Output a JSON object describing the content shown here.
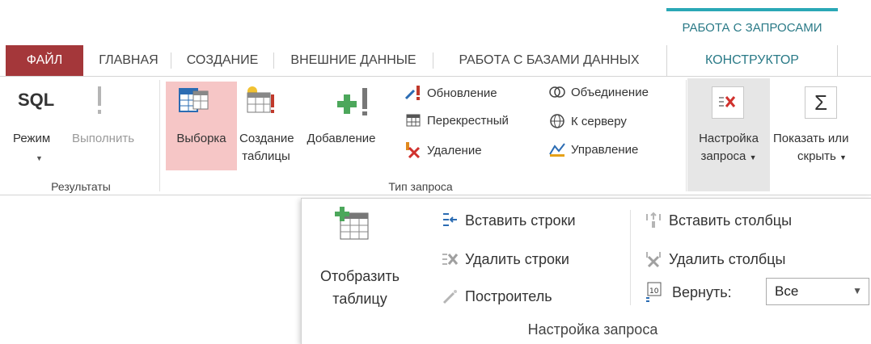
{
  "context_tab_header": "РАБОТА С ЗАПРОСАМИ",
  "tabs": [
    {
      "label": "ФАЙЛ"
    },
    {
      "label": "ГЛАВНАЯ"
    },
    {
      "label": "СОЗДАНИЕ"
    },
    {
      "label": "ВНЕШНИЕ ДАННЫЕ"
    },
    {
      "label": "РАБОТА С БАЗАМИ ДАННЫХ"
    },
    {
      "label": "КОНСТРУКТОР",
      "active": true
    }
  ],
  "ribbon": {
    "results": {
      "sql_text": "SQL",
      "mode_label": "Режим",
      "run_label": "Выполнить",
      "group_label": "Результаты"
    },
    "query_type": {
      "select_label": "Выборка",
      "make_table_label_1": "Создание",
      "make_table_label_2": "таблицы",
      "append_label": "Добавление",
      "update_label": "Обновление",
      "crosstab_label": "Перекрестный",
      "delete_label": "Удаление",
      "union_label": "Объединение",
      "passthrough_label": "К серверу",
      "ddl_label": "Управление",
      "group_label": "Тип запроса"
    },
    "query_setup": {
      "label_1": "Настройка",
      "label_2": "запроса"
    },
    "show_hide": {
      "label_1": "Показать или",
      "label_2": "скрыть"
    }
  },
  "popup": {
    "show_table_label_1": "Отобразить",
    "show_table_label_2": "таблицу",
    "insert_rows": "Вставить строки",
    "delete_rows": "Удалить строки",
    "builder": "Построитель",
    "insert_columns": "Вставить столбцы",
    "delete_columns": "Удалить столбцы",
    "return_label": "Вернуть:",
    "return_value": "Все",
    "group_label": "Настройка запроса"
  },
  "colors": {
    "file_tab": "#a4373a",
    "context_accent": "#2aa8b6",
    "highlight": "#f6c6c6",
    "green_icon": "#4ca75b"
  }
}
